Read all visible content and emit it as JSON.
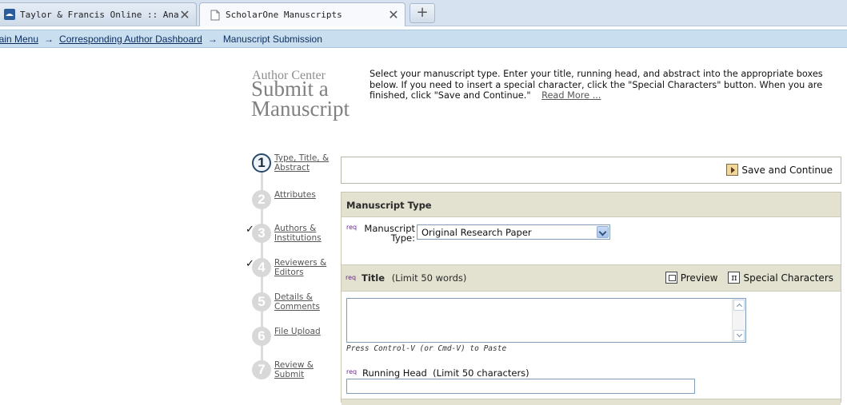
{
  "browser": {
    "tabs": [
      {
        "label": "Taylor & Francis Online :: Anal...",
        "active": false
      },
      {
        "label": "ScholarOne Manuscripts",
        "active": true
      }
    ],
    "close_glyph": "✕",
    "new_tab_glyph": "+"
  },
  "breadcrumb": {
    "items": [
      "Main Menu",
      "Corresponding Author Dashboard",
      "Manuscript Submission"
    ],
    "separator": "→",
    "first_visible": "lain Menu"
  },
  "header": {
    "section": "Author Center",
    "title": "Submit a Manuscript",
    "instructions": "Select your manuscript type. Enter your title, running head, and abstract into the appropriate boxes below. If you need to insert a special character, click the \"Special Characters\" button. When you are finished, click \"Save and Continue.\"",
    "read_more": "Read More ..."
  },
  "steps": [
    {
      "num": "1",
      "label": "Type, Title, & Abstract",
      "active": true,
      "checked": false
    },
    {
      "num": "2",
      "label": "Attributes",
      "active": false,
      "checked": false
    },
    {
      "num": "3",
      "label": "Authors & Institutions",
      "active": false,
      "checked": true
    },
    {
      "num": "4",
      "label": "Reviewers & Editors",
      "active": false,
      "checked": true
    },
    {
      "num": "5",
      "label": "Details & Comments",
      "active": false,
      "checked": false
    },
    {
      "num": "6",
      "label": "File Upload",
      "active": false,
      "checked": false
    },
    {
      "num": "7",
      "label": "Review & Submit",
      "active": false,
      "checked": false
    }
  ],
  "check_glyph": "✓",
  "save_button": {
    "label": "Save and Continue"
  },
  "form": {
    "section_title": "Manuscript Type",
    "req_tag": "req",
    "manuscript_type": {
      "label": "Manuscript Type:",
      "value": "Original Research Paper"
    },
    "title_field": {
      "label": "Title",
      "limit": "(Limit 50 words)",
      "value": ""
    },
    "preview_label": "Preview",
    "special_chars_label": "Special Characters",
    "special_chars_glyph": "π",
    "paste_hint": "Press Control-V (or Cmd-V) to Paste",
    "running_head": {
      "label": "Running Head",
      "limit": "(Limit 50 characters)",
      "value": ""
    }
  },
  "colors": {
    "breadcrumb_bg": "#c9dff0",
    "panel_header_bg": "#e3e1cf",
    "req_color": "#6a2a8a"
  }
}
